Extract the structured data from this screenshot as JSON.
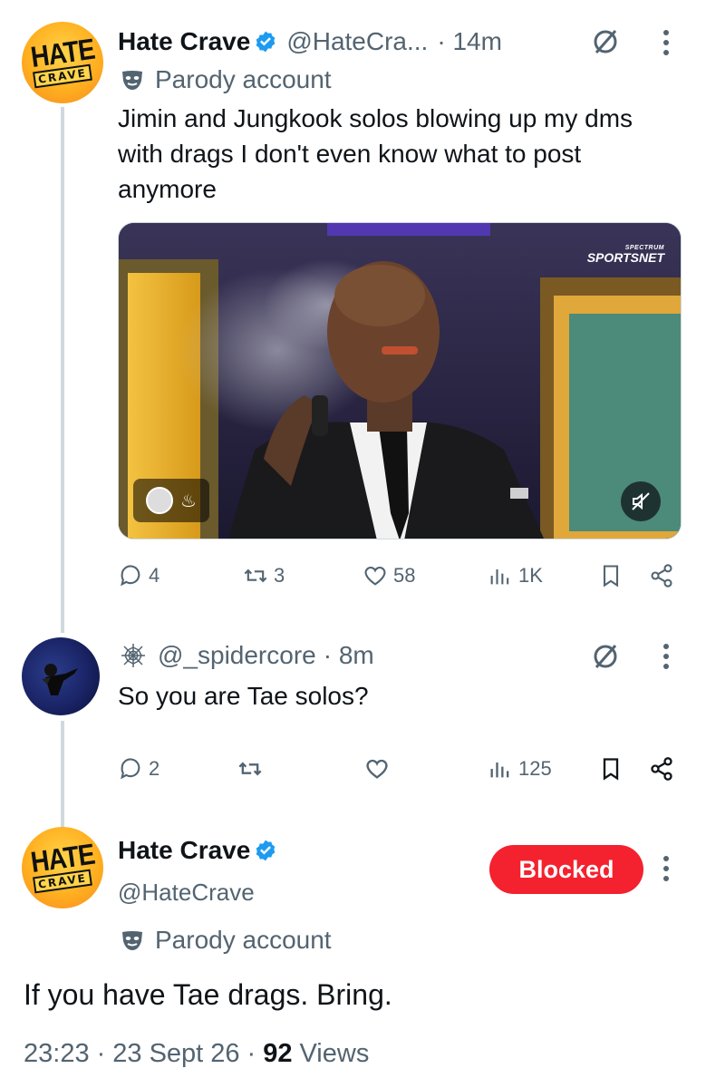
{
  "parent_tweet": {
    "avatar_text": [
      "HATE",
      "CRAVE"
    ],
    "display_name": "Hate Crave",
    "handle": "@HateCra...",
    "time": "· 14m",
    "label": "Parody account",
    "text": "Jimin and Jungkook solos blowing up my dms with drags I don't even know what to post anymore",
    "media": {
      "watermark_small": "SPECTRUM",
      "watermark_big": "SPORTSNET"
    },
    "stats": {
      "replies": "4",
      "reposts": "3",
      "likes": "58",
      "views": "1K"
    }
  },
  "reply_tweet": {
    "handle": "@_spidercore",
    "time": "· 8m",
    "text": "So you are Tae solos?",
    "stats": {
      "replies": "2",
      "views": "125"
    }
  },
  "main_tweet": {
    "avatar_text": [
      "HATE",
      "CRAVE"
    ],
    "display_name": "Hate Crave",
    "handle": "@HateCrave",
    "blocked_label": "Blocked",
    "label": "Parody account",
    "text": "If you have Tae drags. Bring.",
    "time": "23:23",
    "date": "23 Sept 26",
    "views_count": "92",
    "views_label": "Views"
  },
  "colors": {
    "verified_blue": "#1d9bf0",
    "blocked_red": "#f4212e",
    "muted": "#536471"
  }
}
